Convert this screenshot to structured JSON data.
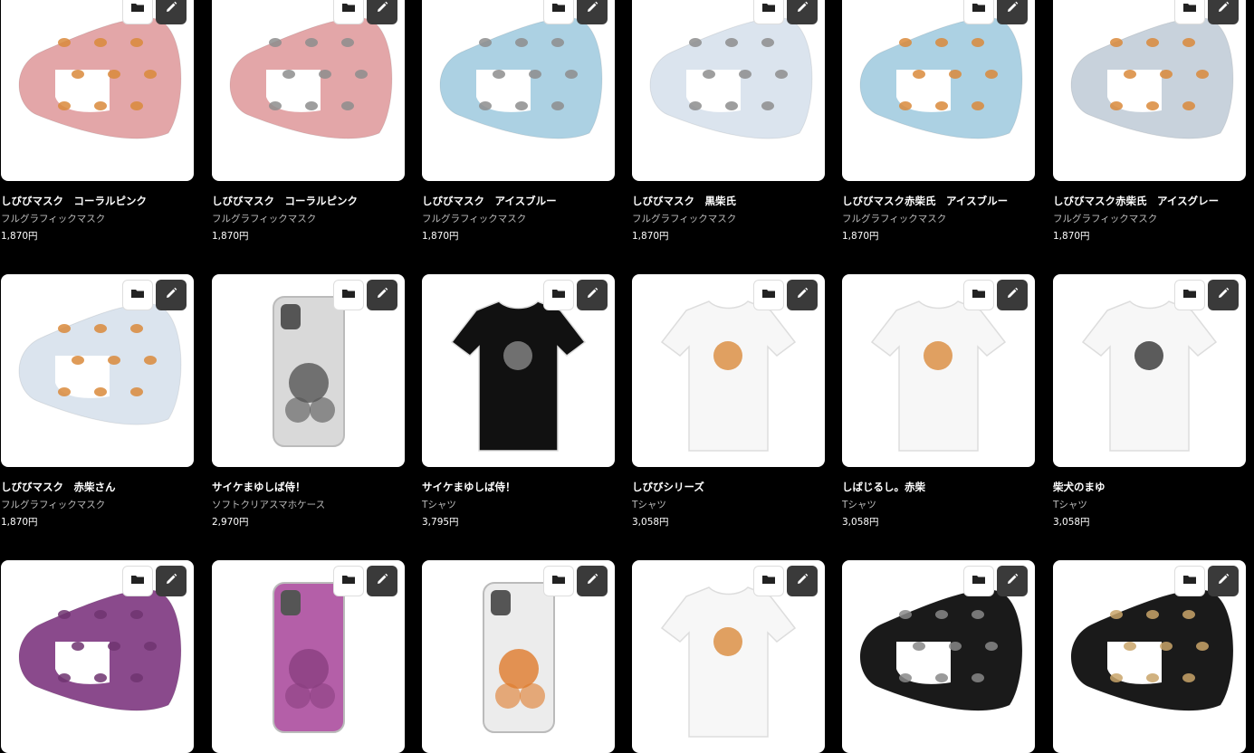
{
  "icons": {
    "folder": "folder-icon",
    "edit": "pencil-icon"
  },
  "rows": [
    {
      "items": [
        {
          "title": "しびびマスク　コーラルピンク",
          "type": "フルグラフィックマスク",
          "price": "1,870円",
          "kind": "mask",
          "color": "#e3a6a8",
          "dog": "#d9893b"
        },
        {
          "title": "しびびマスク　コーラルピンク",
          "type": "フルグラフィックマスク",
          "price": "1,870円",
          "kind": "mask",
          "color": "#e3a6a8",
          "dog": "#8d8d8d"
        },
        {
          "title": "しびびマスク　アイスブルー",
          "type": "フルグラフィックマスク",
          "price": "1,870円",
          "kind": "mask",
          "color": "#acd1e3",
          "dog": "#8d8d8d"
        },
        {
          "title": "しびびマスク　黒柴氏",
          "type": "フルグラフィックマスク",
          "price": "1,870円",
          "kind": "mask",
          "color": "#dbe4ee",
          "dog": "#8d8d8d"
        },
        {
          "title": "しびびマスク赤柴氏　アイスブルー",
          "type": "フルグラフィックマスク",
          "price": "1,870円",
          "kind": "mask",
          "color": "#acd1e3",
          "dog": "#d9893b"
        },
        {
          "title": "しびびマスク赤柴氏　アイスグレー",
          "type": "フルグラフィックマスク",
          "price": "1,870円",
          "kind": "mask",
          "color": "#c8d2dc",
          "dog": "#d9893b"
        }
      ]
    },
    {
      "items": [
        {
          "title": "しびびマスク　赤柴さん",
          "type": "フルグラフィックマスク",
          "price": "1,870円",
          "kind": "mask",
          "color": "#dbe4ee",
          "dog": "#d9893b"
        },
        {
          "title": "サイケまゆしば侍！",
          "type": "ソフトクリアスマホケース",
          "price": "2,970円",
          "kind": "phone",
          "color": "#d9d9d9",
          "dog": "#555"
        },
        {
          "title": "サイケまゆしば侍！",
          "type": "Tシャツ",
          "price": "3,795円",
          "kind": "tshirt",
          "color": "#111",
          "dog": "#888"
        },
        {
          "title": "しびびシリーズ",
          "type": "Tシャツ",
          "price": "3,058円",
          "kind": "tshirt",
          "color": "#f7f7f7",
          "dog": "#d9893b"
        },
        {
          "title": "しばじるし。赤柴",
          "type": "Tシャツ",
          "price": "3,058円",
          "kind": "tshirt",
          "color": "#f7f7f7",
          "dog": "#d9893b"
        },
        {
          "title": "柴犬のまゆ",
          "type": "Tシャツ",
          "price": "3,058円",
          "kind": "tshirt",
          "color": "#f7f7f7",
          "dog": "#333"
        }
      ]
    },
    {
      "items": [
        {
          "title": "",
          "type": "",
          "price": "",
          "kind": "mask",
          "color": "#8a4a8c",
          "dog": "#6e3470"
        },
        {
          "title": "",
          "type": "",
          "price": "",
          "kind": "phone",
          "color": "#b45fa8",
          "dog": "#8a3f80"
        },
        {
          "title": "",
          "type": "",
          "price": "",
          "kind": "phone",
          "color": "#ececec",
          "dog": "#e07b2c"
        },
        {
          "title": "",
          "type": "",
          "price": "",
          "kind": "tshirt",
          "color": "#f7f7f7",
          "dog": "#d9893b"
        },
        {
          "title": "",
          "type": "",
          "price": "",
          "kind": "mask",
          "color": "#1a1a1a",
          "dog": "#888"
        },
        {
          "title": "",
          "type": "",
          "price": "",
          "kind": "mask",
          "color": "#1a1a1a",
          "dog": "#c9a46a"
        }
      ]
    }
  ]
}
